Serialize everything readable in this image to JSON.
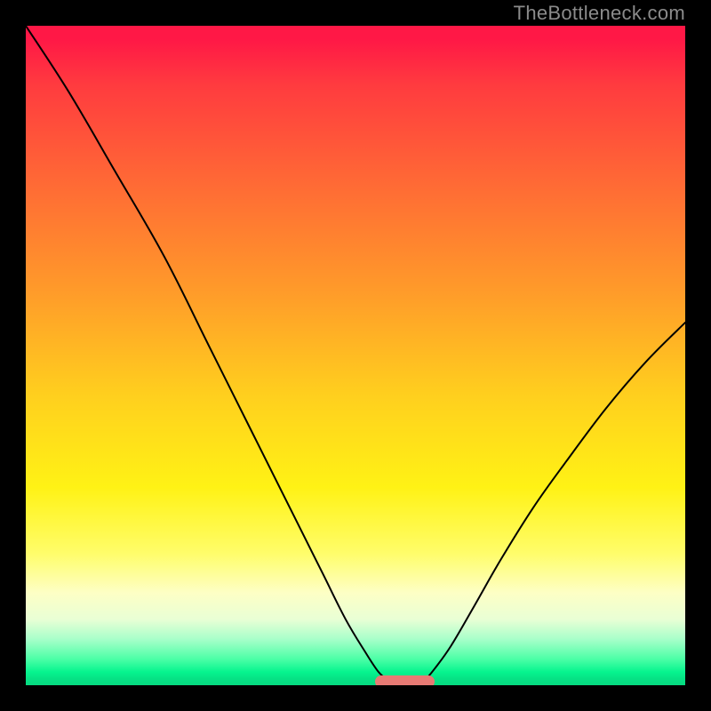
{
  "watermark": "TheBottleneck.com",
  "chart_data": {
    "type": "line",
    "title": "",
    "xlabel": "",
    "ylabel": "",
    "xlim": [
      0,
      100
    ],
    "ylim": [
      0,
      100
    ],
    "series": [
      {
        "name": "bottleneck-curve-left",
        "x": [
          0,
          6.5,
          13.5,
          21,
          28,
          35,
          40.5,
          45,
          48.5,
          51.5,
          53.5,
          55
        ],
        "values": [
          100,
          90,
          78,
          65,
          51,
          37,
          26,
          17,
          10,
          5,
          2,
          0.7
        ]
      },
      {
        "name": "bottleneck-curve-right",
        "x": [
          60.5,
          62,
          64.5,
          68,
          72,
          77,
          82,
          88,
          94,
          100
        ],
        "values": [
          0.7,
          2.5,
          6,
          12,
          19,
          27,
          34,
          42,
          49,
          55
        ]
      }
    ],
    "marker": {
      "x_start": 53,
      "x_end": 62,
      "y": 0.5
    },
    "gradient_stops": [
      {
        "pct": 0,
        "color": "#ff1846"
      },
      {
        "pct": 24,
        "color": "#ff6a35"
      },
      {
        "pct": 56,
        "color": "#ffcf1e"
      },
      {
        "pct": 80,
        "color": "#fffd6a"
      },
      {
        "pct": 96,
        "color": "#4dffa7"
      },
      {
        "pct": 100,
        "color": "#06da80"
      }
    ]
  }
}
